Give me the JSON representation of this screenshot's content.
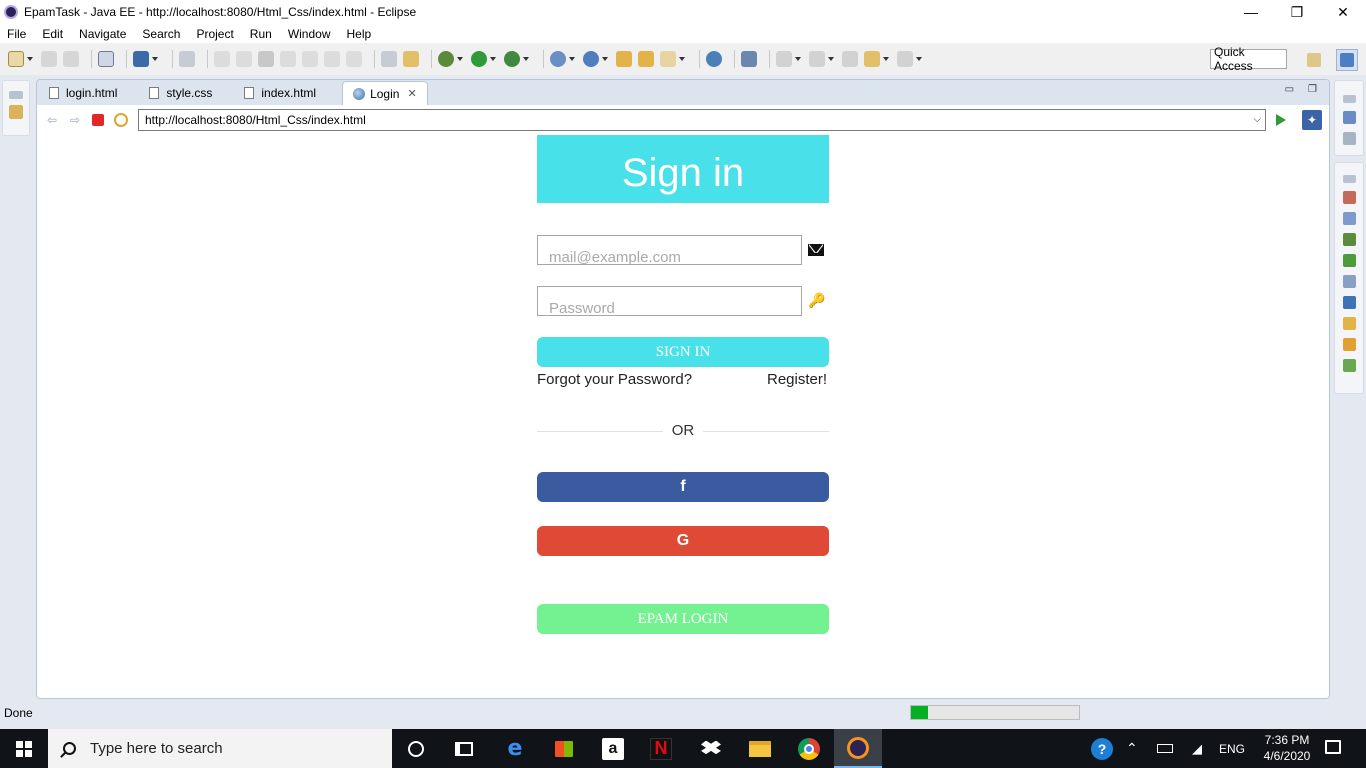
{
  "window": {
    "title": "EpamTask - Java EE - http://localhost:8080/Html_Css/index.html - Eclipse",
    "minimize": "—",
    "restore": "❐",
    "close": "✕"
  },
  "menu": {
    "items": [
      "File",
      "Edit",
      "Navigate",
      "Search",
      "Project",
      "Run",
      "Window",
      "Help"
    ]
  },
  "toolbar": {
    "quick_access": "Quick Access"
  },
  "editor": {
    "tabs": [
      {
        "label": "login.html",
        "icon": "html-file-icon"
      },
      {
        "label": "style.css",
        "icon": "css-file-icon"
      },
      {
        "label": "index.html",
        "icon": "html-file-icon"
      },
      {
        "label": "Login",
        "icon": "globe-icon",
        "active": true
      }
    ],
    "close_glyph": "✕",
    "minimize_glyph": "▭",
    "maximize_glyph": "❐"
  },
  "browser": {
    "url": "http://localhost:8080/Html_Css/index.html"
  },
  "login_page": {
    "header": "Sign in",
    "email_placeholder": "mail@example.com",
    "password_placeholder": "Password",
    "sign_in_button": "SIGN IN",
    "forgot_link": "Forgot your Password?",
    "register_link": "Register!",
    "or_text": "OR",
    "facebook_glyph": "f",
    "google_glyph": "G",
    "epam_button": "EPAM LOGIN",
    "colors": {
      "header": "#49e1e9",
      "facebook": "#3a5ba0",
      "google": "#df4a36",
      "epam": "#74f291"
    }
  },
  "status": {
    "text": "Done",
    "progress_fraction": 0.1
  },
  "taskbar": {
    "search_text": "Type here to search",
    "amazon_glyph": "a",
    "netflix_glyph": "N",
    "help_glyph": "?",
    "language": "ENG",
    "time": "7:36 PM",
    "date": "4/6/2020"
  }
}
